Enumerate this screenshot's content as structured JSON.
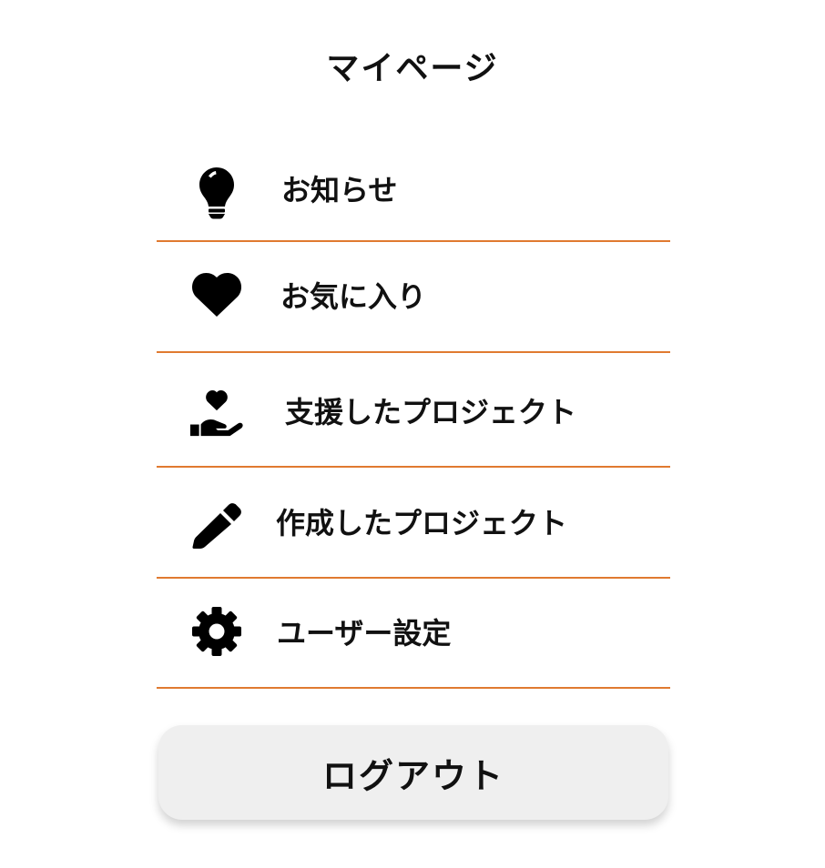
{
  "page": {
    "title": "マイページ"
  },
  "menu": {
    "items": [
      {
        "label": "お知らせ",
        "icon": "lightbulb-icon"
      },
      {
        "label": "お気に入り",
        "icon": "heart-icon"
      },
      {
        "label": "支援したプロジェクト",
        "icon": "hand-holding-heart-icon"
      },
      {
        "label": "作成したプロジェクト",
        "icon": "pencil-icon"
      },
      {
        "label": "ユーザー設定",
        "icon": "gear-icon"
      }
    ]
  },
  "logout": {
    "label": "ログアウト"
  },
  "colors": {
    "divider": "#e07a30",
    "button_background": "#efefef",
    "text": "#111111"
  }
}
